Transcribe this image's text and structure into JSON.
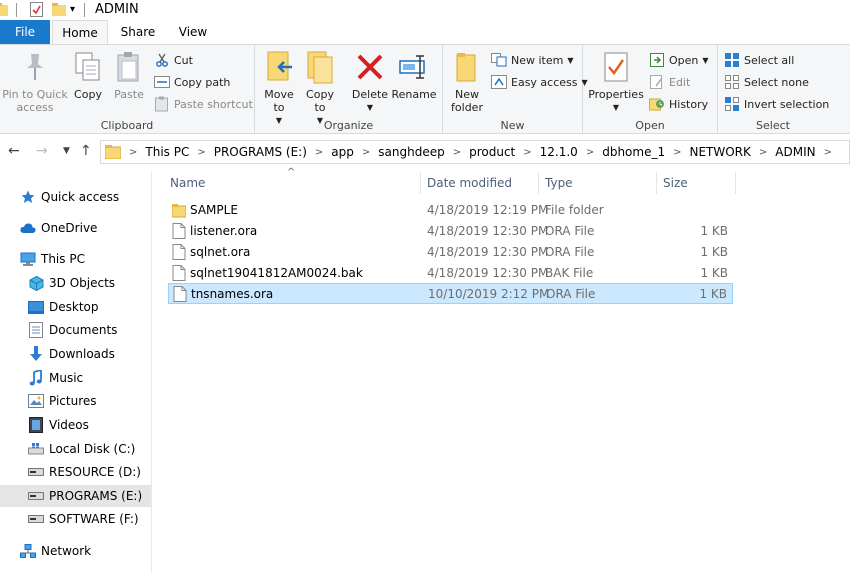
{
  "window": {
    "title": "ADMIN"
  },
  "quick_access_toolbar": {
    "dropdown_glyph": "▾"
  },
  "tabs": [
    {
      "label": "File"
    },
    {
      "label": "Home"
    },
    {
      "label": "Share"
    },
    {
      "label": "View"
    }
  ],
  "ribbon": {
    "clipboard": {
      "label": "Clipboard",
      "pin": "Pin to Quick access",
      "copy": "Copy",
      "paste": "Paste",
      "cut": "Cut",
      "copy_path": "Copy path",
      "paste_shortcut": "Paste shortcut"
    },
    "organize": {
      "label": "Organize",
      "move_to": "Move to",
      "copy_to": "Copy to",
      "delete": "Delete",
      "rename": "Rename"
    },
    "new": {
      "label": "New",
      "new_folder": "New folder",
      "new_item": "New item",
      "easy_access": "Easy access"
    },
    "open": {
      "label": "Open",
      "properties": "Properties",
      "open": "Open",
      "edit": "Edit",
      "history": "History"
    },
    "select": {
      "label": "Select",
      "select_all": "Select all",
      "select_none": "Select none",
      "invert_selection": "Invert selection"
    }
  },
  "address": {
    "crumbs": [
      "This PC",
      "PROGRAMS (E:)",
      "app",
      "sanghdeep",
      "product",
      "12.1.0",
      "dbhome_1",
      "NETWORK",
      "ADMIN"
    ]
  },
  "nav_pane": {
    "items": [
      {
        "label": "Quick access",
        "icon": "star-icon"
      },
      {
        "label": "OneDrive",
        "icon": "cloud-icon"
      },
      {
        "label": "This PC",
        "icon": "computer-icon"
      },
      {
        "label": "3D Objects",
        "icon": "cube-icon"
      },
      {
        "label": "Desktop",
        "icon": "desktop-icon"
      },
      {
        "label": "Documents",
        "icon": "documents-icon"
      },
      {
        "label": "Downloads",
        "icon": "download-icon"
      },
      {
        "label": "Music",
        "icon": "music-icon"
      },
      {
        "label": "Pictures",
        "icon": "pictures-icon"
      },
      {
        "label": "Videos",
        "icon": "video-icon"
      },
      {
        "label": "Local Disk (C:)",
        "icon": "windows-drive-icon"
      },
      {
        "label": "RESOURCE (D:)",
        "icon": "drive-icon"
      },
      {
        "label": "PROGRAMS (E:)",
        "icon": "drive-icon"
      },
      {
        "label": "SOFTWARE (F:)",
        "icon": "drive-icon"
      },
      {
        "label": "Network",
        "icon": "network-icon"
      }
    ]
  },
  "file_list": {
    "columns": {
      "name": "Name",
      "date": "Date modified",
      "type": "Type",
      "size": "Size"
    },
    "rows": [
      {
        "name": "SAMPLE",
        "date": "4/18/2019 12:19 PM",
        "type": "File folder",
        "size": "",
        "icon": "folder-icon"
      },
      {
        "name": "listener.ora",
        "date": "4/18/2019 12:30 PM",
        "type": "ORA File",
        "size": "1 KB",
        "icon": "file-icon"
      },
      {
        "name": "sqlnet.ora",
        "date": "4/18/2019 12:30 PM",
        "type": "ORA File",
        "size": "1 KB",
        "icon": "file-icon"
      },
      {
        "name": "sqlnet19041812AM0024.bak",
        "date": "4/18/2019 12:30 PM",
        "type": "BAK File",
        "size": "1 KB",
        "icon": "file-icon"
      },
      {
        "name": "tnsnames.ora",
        "date": "10/10/2019 2:12 PM",
        "type": "ORA File",
        "size": "1 KB",
        "icon": "file-icon",
        "selected": true
      }
    ]
  }
}
